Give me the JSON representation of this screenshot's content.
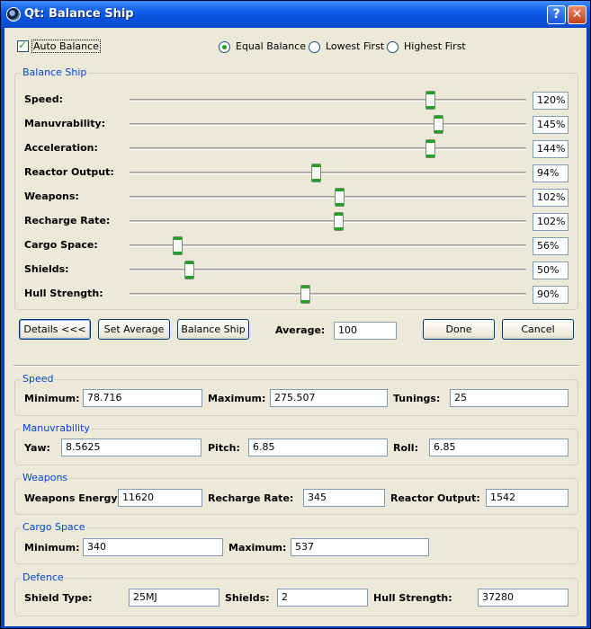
{
  "window": {
    "title": "Qt: Balance Ship"
  },
  "top": {
    "auto_balance": {
      "label": "Auto Balance",
      "checked": true
    },
    "modes": [
      {
        "label": "Equal Balance",
        "selected": true
      },
      {
        "label": "Lowest First",
        "selected": false
      },
      {
        "label": "Highest First",
        "selected": false
      }
    ]
  },
  "balance": {
    "title": "Balance Ship",
    "rows": [
      {
        "label": "Speed:",
        "value": "120%",
        "slider": 0.766
      },
      {
        "label": "Manuvrability:",
        "value": "145%",
        "slider": 0.786
      },
      {
        "label": "Acceleration:",
        "value": "144%",
        "slider": 0.764
      },
      {
        "label": "Reactor Output:",
        "value": "94%",
        "slider": 0.47
      },
      {
        "label": "Weapons:",
        "value": "102%",
        "slider": 0.531
      },
      {
        "label": "Recharge Rate:",
        "value": "102%",
        "slider": 0.527
      },
      {
        "label": "Cargo Space:",
        "value": "56%",
        "slider": 0.111
      },
      {
        "label": "Shields:",
        "value": "50%",
        "slider": 0.143
      },
      {
        "label": "Hull Strength:",
        "value": "90%",
        "slider": 0.443
      }
    ]
  },
  "actions": {
    "details": "Details <<<",
    "set_average": "Set Average",
    "balance_ship": "Balance Ship",
    "average_label": "Average:",
    "average_value": "100",
    "done": "Done",
    "cancel": "Cancel"
  },
  "speed": {
    "title": "Speed",
    "min_label": "Minimum:",
    "min": "78.716",
    "max_label": "Maximum:",
    "max": "275.507",
    "tunings_label": "Tunings:",
    "tunings": "25"
  },
  "manuv": {
    "title": "Manuvrability",
    "yaw_label": "Yaw:",
    "yaw": "8.5625",
    "pitch_label": "Pitch:",
    "pitch": "6.85",
    "roll_label": "Roll:",
    "roll": "6.85"
  },
  "weapons": {
    "title": "Weapons",
    "energy_label": "Weapons Energy:",
    "energy": "11620",
    "recharge_label": "Recharge Rate:",
    "recharge": "345",
    "reactor_label": "Reactor Output:",
    "reactor": "1542"
  },
  "cargo": {
    "title": "Cargo Space",
    "min_label": "Minimum:",
    "min": "340",
    "max_label": "Maximum:",
    "max": "537"
  },
  "defence": {
    "title": "Defence",
    "type_label": "Shield Type:",
    "type": "25MJ",
    "shields_label": "Shields:",
    "shields": "2",
    "hull_label": "Hull Strength:",
    "hull": "37280"
  }
}
